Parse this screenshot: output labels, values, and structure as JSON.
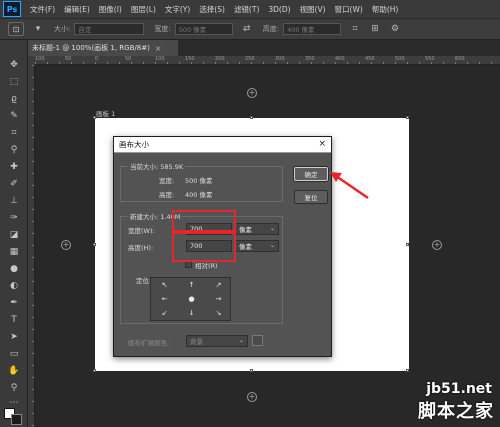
{
  "app": {
    "logo": "Ps"
  },
  "menu": [
    "文件(F)",
    "编辑(E)",
    "图像(I)",
    "图层(L)",
    "文字(Y)",
    "选择(S)",
    "滤镜(T)",
    "3D(D)",
    "视图(V)",
    "窗口(W)",
    "帮助(H)"
  ],
  "options": {
    "size_label": "大小:",
    "size_value": "自定",
    "width_label": "宽度:",
    "width_value": "500 像素",
    "height_label": "高度:",
    "height_value": "400 像素"
  },
  "document": {
    "tab_title": "未标题-1 @ 100%(画板 1, RGB/8#)",
    "tab_close": "×",
    "artboard_label": "画板 1"
  },
  "ruler": [
    "100",
    "50",
    "0",
    "50",
    "100",
    "150",
    "200",
    "250",
    "300",
    "350",
    "400",
    "450",
    "500",
    "550",
    "600"
  ],
  "dialog": {
    "title": "画布大小",
    "close": "×",
    "current_group_title": "当前大小: 585.9K",
    "current_width_label": "宽度:",
    "current_width_value": "500 像素",
    "current_height_label": "高度:",
    "current_height_value": "400 像素",
    "new_group_title": "新建大小: 1.40M",
    "new_width_label": "宽度(W):",
    "new_width_value": "700",
    "new_width_unit": "像素",
    "new_height_label": "高度(H):",
    "new_height_value": "700",
    "new_height_unit": "像素",
    "relative_label": "相对(R)",
    "anchor_label": "定位:",
    "anchor_arrows": [
      "↖",
      "↑",
      "↗",
      "←",
      "●",
      "→",
      "↙",
      "↓",
      "↘"
    ],
    "ext_color_label": "画布扩展颜色:",
    "ext_color_value": "背景",
    "ok_button": "确定",
    "reset_button": "复位"
  },
  "watermark": {
    "site": "jb51.net",
    "name": "脚本之家"
  },
  "colors": {
    "highlight": "#e5262a",
    "dialog_bg": "#535353",
    "canvas": "#ffffff",
    "workspace": "#282828"
  }
}
